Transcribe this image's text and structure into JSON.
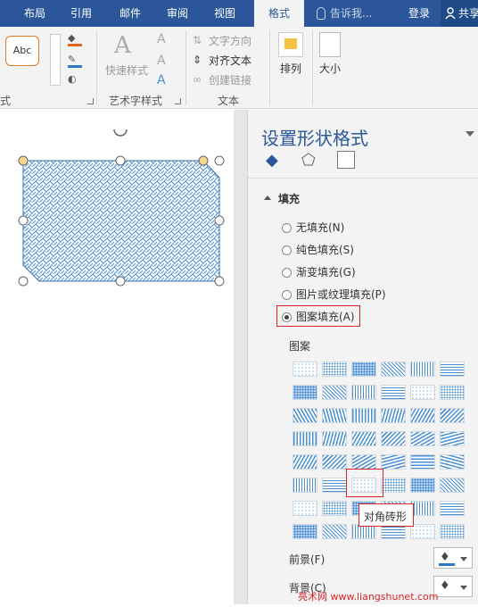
{
  "tabs": [
    {
      "label": "布局"
    },
    {
      "label": "引用"
    },
    {
      "label": "邮件"
    },
    {
      "label": "审阅"
    },
    {
      "label": "视图"
    },
    {
      "label": "格式"
    },
    {
      "label": "告诉我..."
    },
    {
      "label": "登录"
    },
    {
      "label": "共享"
    }
  ],
  "ribbon": {
    "shape_style_group": "式",
    "abc_label": "Abc",
    "quick_styles": "快速样式",
    "art_group": "艺术字样式",
    "text_direction": "文字方向",
    "align_text": "对齐文本",
    "create_link": "创建链接",
    "text_group": "文本",
    "arrange": "排列",
    "size": "大小"
  },
  "pane": {
    "title": "设置形状格式",
    "section": "填充",
    "options": [
      {
        "label": "无填充(N)"
      },
      {
        "label": "纯色填充(S)"
      },
      {
        "label": "渐变填充(G)"
      },
      {
        "label": "图片或纹理填充(P)"
      },
      {
        "label": "图案填充(A)"
      }
    ],
    "pattern_label": "图案",
    "tooltip": "对角砖形",
    "foreground": "前景(F)",
    "background": "背景(C)"
  },
  "watermark": "亮术网 www.liangshunet.com",
  "colors": {
    "brand": "#2b579a",
    "pattern_blue": "#4a8fd4",
    "highlight_red": "#d9262a"
  }
}
